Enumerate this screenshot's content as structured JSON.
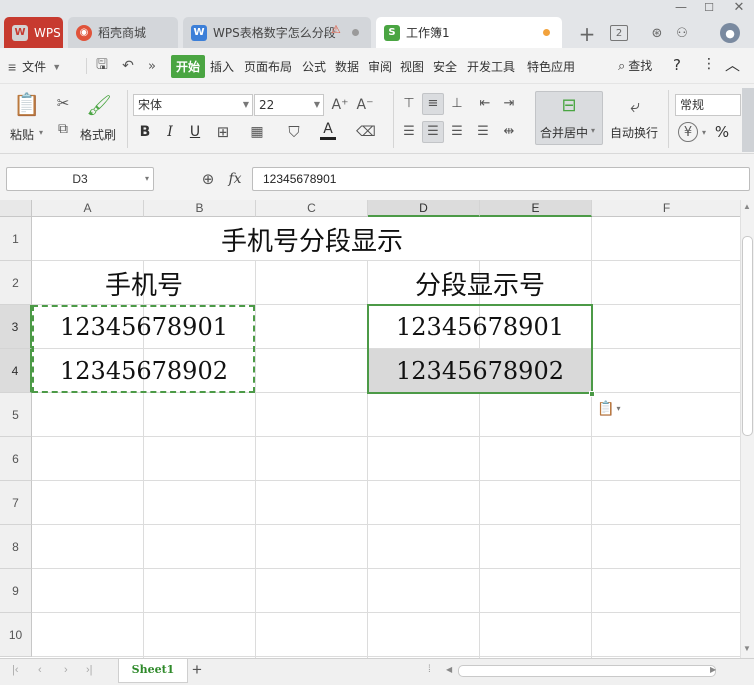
{
  "tabs": [
    {
      "label": "WPS",
      "icon": "wps-logo-icon"
    },
    {
      "label": "稻壳商城",
      "icon": "docer-icon"
    },
    {
      "label": "WPS表格数字怎么分段",
      "icon": "doc-icon"
    },
    {
      "label": "工作簿1",
      "icon": "sheet-icon"
    }
  ],
  "tab_badge": "2",
  "menu": {
    "file": "文件",
    "items": [
      "开始",
      "插入",
      "页面布局",
      "公式",
      "数据",
      "审阅",
      "视图",
      "安全",
      "开发工具",
      "特色应用"
    ],
    "search": "查找",
    "help": "?",
    "more": "⋮"
  },
  "ribbon": {
    "paste": "粘贴",
    "format_painter": "格式刷",
    "font_name": "宋体",
    "font_size": "22",
    "merge_center": "合并居中",
    "wrap_text": "自动换行",
    "number_format": "常规",
    "bold": "B",
    "italic": "I",
    "underline": "U",
    "font_color_label": "A",
    "increase_font": "A⁺",
    "decrease_font": "A⁻",
    "percent": "%"
  },
  "formula_bar": {
    "name_box": "D3",
    "fx": "fx",
    "value": "12345678901"
  },
  "grid": {
    "columns": [
      "A",
      "B",
      "C",
      "D",
      "E",
      "F"
    ],
    "rows": [
      "1",
      "2",
      "3",
      "4",
      "5",
      "6",
      "7",
      "8",
      "9",
      "10"
    ],
    "title": "手机号分段显示",
    "header_left": "手机号",
    "header_right": "分段显示号",
    "a3": "12345678901",
    "a4": "12345678902",
    "d3": "12345678901",
    "d4": "12345678902"
  },
  "sheet_tab": "Sheet1",
  "colors": {
    "accent": "#4aa542",
    "selection_border": "#4c9a47",
    "wps_tab": "#c73a2f",
    "selected_fill": "#d9d9d9"
  }
}
